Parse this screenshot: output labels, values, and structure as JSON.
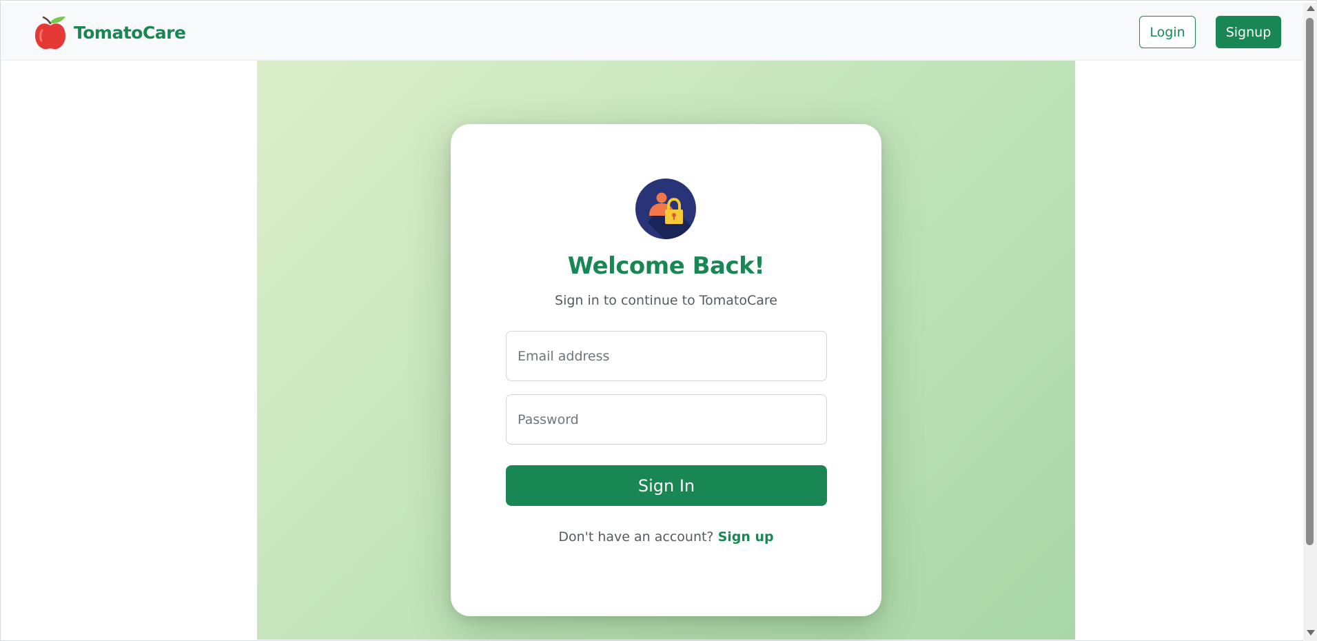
{
  "navbar": {
    "brand_name": "TomatoCare",
    "brand_icon": "tomato-icon",
    "login_label": "Login",
    "signup_label": "Signup"
  },
  "login_card": {
    "avatar_icon": "user-lock-icon",
    "title": "Welcome Back!",
    "subtitle": "Sign in to continue to TomatoCare",
    "email_placeholder": "Email address",
    "email_value": "",
    "password_placeholder": "Password",
    "password_value": "",
    "submit_label": "Sign In",
    "footer_prompt": "Don't have an account?",
    "footer_link": "Sign up"
  },
  "colors": {
    "brand_green": "#198754",
    "navbar_bg": "#f8f9fa",
    "hero_gradient_start": "#dbeeca",
    "hero_gradient_end": "#a9d7a7",
    "avatar_bg": "#283477",
    "lock_yellow": "#f8c937"
  }
}
